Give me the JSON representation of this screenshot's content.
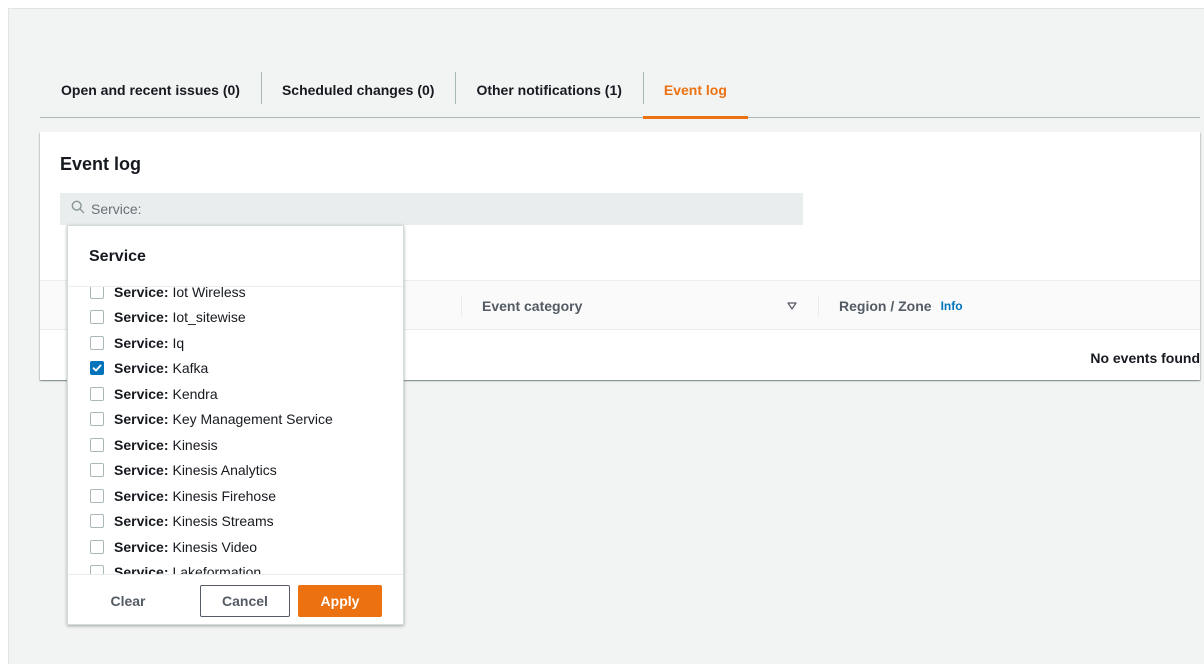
{
  "tabs": [
    {
      "label": "Open and recent issues (0)",
      "active": false
    },
    {
      "label": "Scheduled changes (0)",
      "active": false
    },
    {
      "label": "Other notifications (1)",
      "active": false
    },
    {
      "label": "Event log",
      "active": true
    }
  ],
  "panel": {
    "title": "Event log",
    "search": {
      "placeholder": "Service:",
      "value": ""
    },
    "columns": {
      "event_category": "Event category",
      "region_zone": "Region / Zone",
      "info_link": "Info"
    },
    "empty_message": "No events found"
  },
  "dropdown": {
    "title": "Service",
    "option_prefix": "Service:",
    "options": [
      {
        "label": "Iot Wireless",
        "checked": false
      },
      {
        "label": "Iot_sitewise",
        "checked": false
      },
      {
        "label": "Iq",
        "checked": false
      },
      {
        "label": "Kafka",
        "checked": true
      },
      {
        "label": "Kendra",
        "checked": false
      },
      {
        "label": "Key Management Service",
        "checked": false
      },
      {
        "label": "Kinesis",
        "checked": false
      },
      {
        "label": "Kinesis Analytics",
        "checked": false
      },
      {
        "label": "Kinesis Firehose",
        "checked": false
      },
      {
        "label": "Kinesis Streams",
        "checked": false
      },
      {
        "label": "Kinesis Video",
        "checked": false
      },
      {
        "label": "Lakeformation",
        "checked": false
      }
    ],
    "buttons": {
      "clear": "Clear",
      "cancel": "Cancel",
      "apply": "Apply"
    }
  },
  "icons": {
    "search": "search-icon",
    "sort": "sort-down-icon",
    "check": "check-icon"
  },
  "colors": {
    "accent": "#ec7211",
    "link": "#0073bb",
    "checked": "#0073bb"
  }
}
